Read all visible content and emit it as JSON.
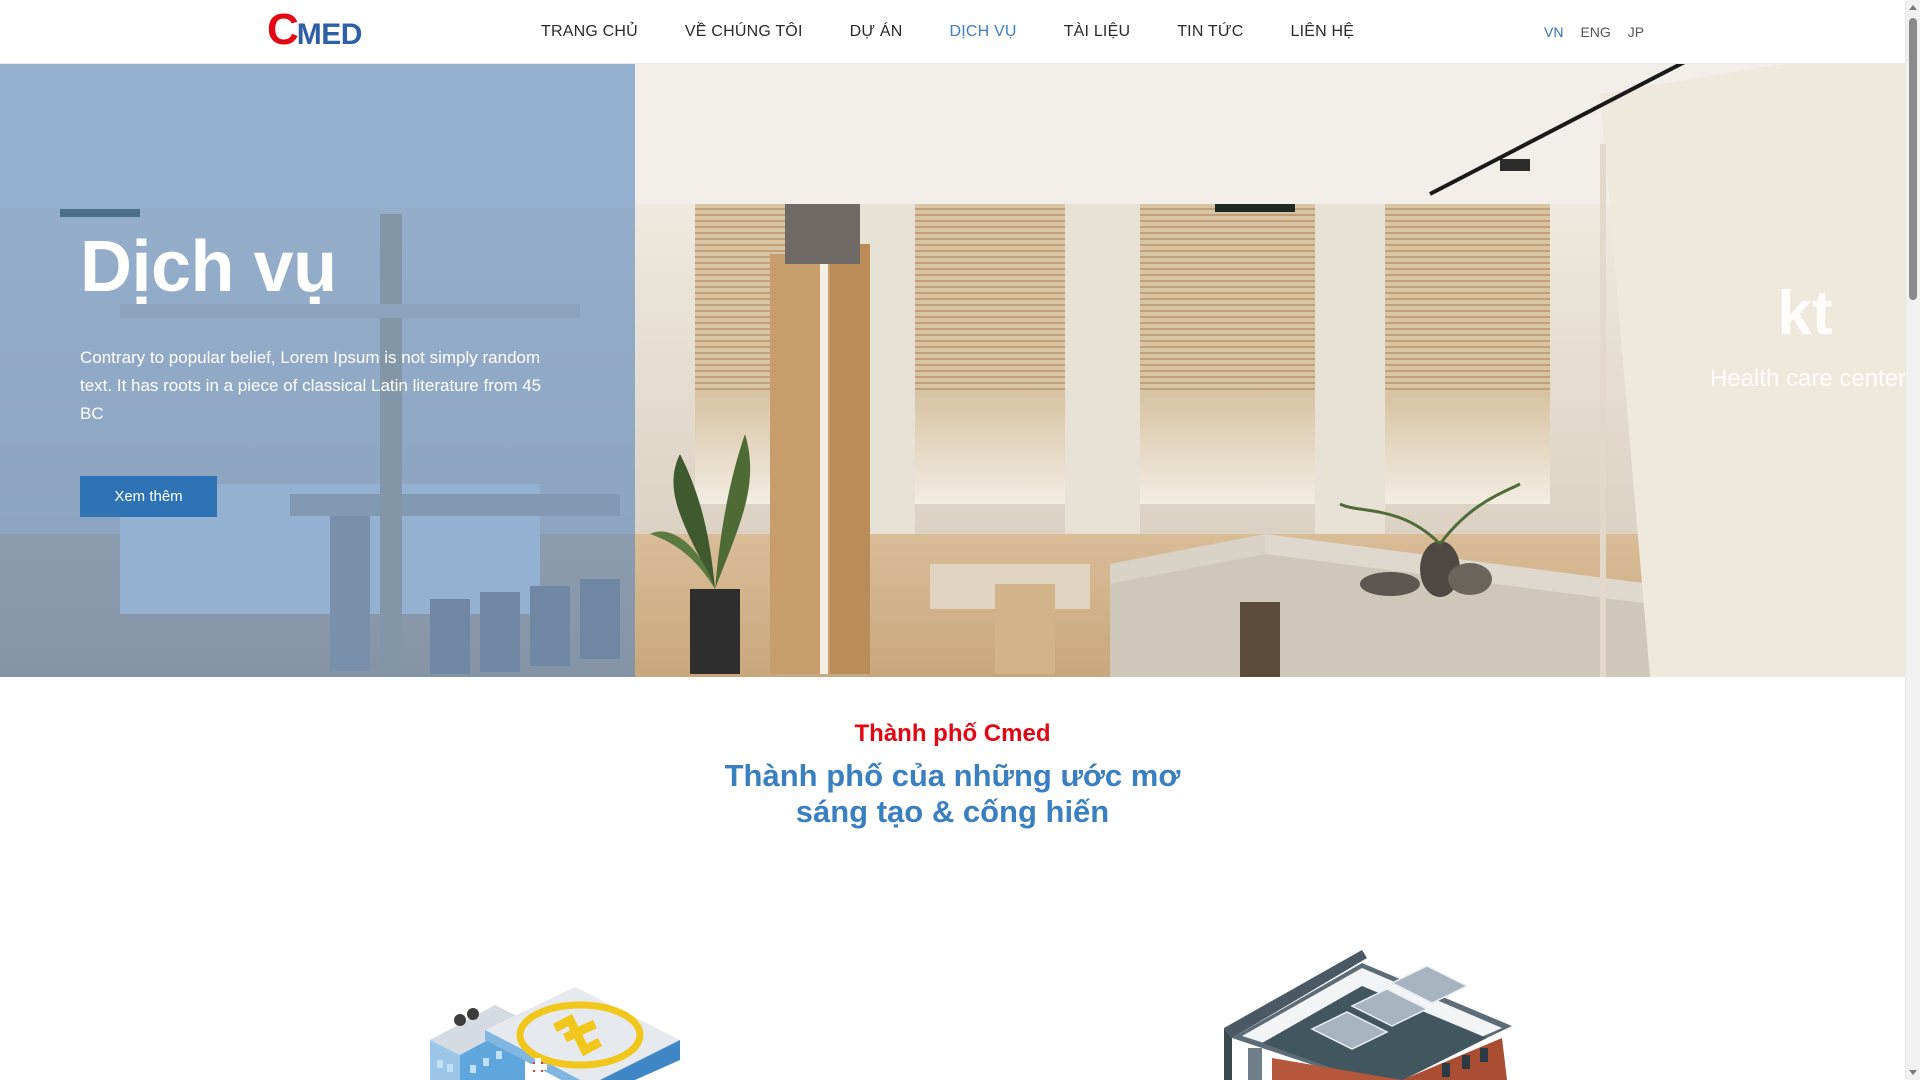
{
  "brand": {
    "logo_initial": "C",
    "logo_rest": "MED",
    "logo_colors": {
      "initial": "#e30613",
      "rest": "#2e5fa7"
    }
  },
  "nav": {
    "items": [
      {
        "label": "TRANG CHỦ",
        "active": false
      },
      {
        "label": "VỀ CHÚNG TÔI",
        "active": false
      },
      {
        "label": "DỰ ÁN",
        "active": false
      },
      {
        "label": "DỊCH VỤ",
        "active": true
      },
      {
        "label": "TÀI LIỆU",
        "active": false
      },
      {
        "label": "TIN TỨC",
        "active": false
      },
      {
        "label": "LIÊN HỆ",
        "active": false
      }
    ],
    "active_color": "#3d7fc1"
  },
  "languages": [
    {
      "label": "VN",
      "active": true
    },
    {
      "label": "ENG",
      "active": false
    },
    {
      "label": "JP",
      "active": false
    }
  ],
  "hero": {
    "title": "Dịch vụ",
    "description": "Contrary to popular belief, Lorem Ipsum is not simply random text. It has roots in a piece of classical Latin literature from 45 BC",
    "button_label": "Xem thêm",
    "overlay_color": "#5c89be",
    "wall_sign_logo": "kt",
    "wall_sign_text": "Health care center"
  },
  "section": {
    "kicker": "Thành phố Cmed",
    "title_line1": "Thành phố của những ước mơ",
    "title_line2": "sáng tạo & cống hiến",
    "kicker_color": "#e30613",
    "title_color": "#3a7fc0"
  },
  "illustrations": [
    "hospital-building-icon",
    "solar-roof-building-icon"
  ]
}
